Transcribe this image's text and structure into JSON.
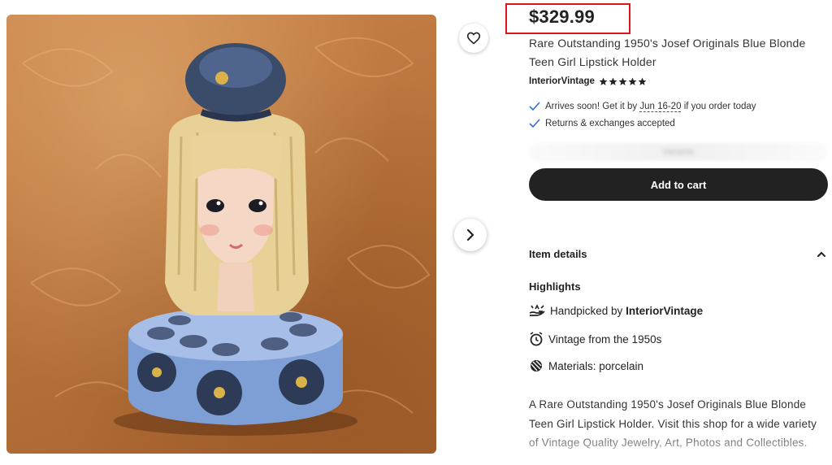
{
  "listing": {
    "price": "$329.99",
    "title": "Rare Outstanding 1950's Josef Originals Blue Blonde Teen Girl Lipstick Holder",
    "shop_name": "InteriorVintage",
    "rating_stars": 5
  },
  "shipping": {
    "arrival_prefix": "Arrives soon! Get it by",
    "arrival_date": "Jun 16-20",
    "arrival_suffix": "if you order today",
    "returns": "Returns & exchanges accepted"
  },
  "variant_placeholder": "Variants",
  "actions": {
    "add_to_cart": "Add to cart"
  },
  "details": {
    "heading": "Item details",
    "highlights_heading": "Highlights",
    "handpicked_prefix": "Handpicked by",
    "handpicked_shop": "InteriorVintage",
    "vintage": "Vintage from the 1950s",
    "materials": "Materials: porcelain"
  },
  "description": "A Rare Outstanding 1950's Josef Originals Blue Blonde Teen Girl Lipstick Holder. Visit this shop for a wide variety of Vintage Quality Jewelry, Art, Photos and Collectibles.",
  "colors": {
    "accent_black": "#222222",
    "highlight_red": "#e0141c",
    "check_blue": "#2f6fd6"
  },
  "icons": [
    "heart-icon",
    "chevron-right-icon",
    "check-icon",
    "star-icon",
    "chevron-up-icon",
    "hand-icon",
    "clock-icon",
    "materials-icon"
  ]
}
